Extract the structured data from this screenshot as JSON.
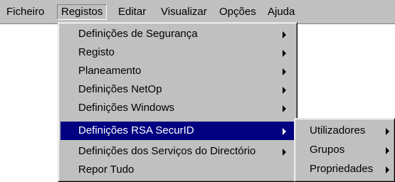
{
  "menubar": {
    "items": [
      {
        "label": "Ficheiro"
      },
      {
        "label": "Registos"
      },
      {
        "label": "Editar"
      },
      {
        "label": "Visualizar"
      },
      {
        "label": "Opções"
      },
      {
        "label": "Ajuda"
      }
    ]
  },
  "registos_menu": {
    "items": [
      {
        "label": "Definições de Segurança",
        "has_submenu": true
      },
      {
        "label": "Registo",
        "has_submenu": true
      },
      {
        "label": "Planeamento",
        "has_submenu": true
      },
      {
        "label": "Definições NetOp",
        "has_submenu": true
      },
      {
        "label": "Definições Windows",
        "has_submenu": true
      },
      {
        "label": "Definições RSA SecurID",
        "has_submenu": true,
        "highlighted": true
      },
      {
        "label": "Definições dos Serviços do Directório",
        "has_submenu": true
      },
      {
        "label": "Repor Tudo",
        "has_submenu": false
      }
    ]
  },
  "securid_submenu": {
    "items": [
      {
        "label": "Utilizadores",
        "has_submenu": true
      },
      {
        "label": "Grupos",
        "has_submenu": true
      },
      {
        "label": "Propriedades",
        "has_submenu": true
      }
    ]
  },
  "colors": {
    "menu_face": "#c0c0c0",
    "highlight": "#000080",
    "highlight_text": "#ffffff"
  }
}
